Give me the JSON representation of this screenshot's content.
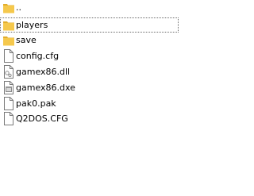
{
  "files": [
    {
      "name": "..",
      "icon": "folder-icon",
      "kind": "folder"
    },
    {
      "name": "players",
      "icon": "folder-icon",
      "kind": "folder",
      "focused": true
    },
    {
      "name": "save",
      "icon": "folder-icon",
      "kind": "folder"
    },
    {
      "name": "config.cfg",
      "icon": "document-icon",
      "kind": "file"
    },
    {
      "name": "gamex86.dll",
      "icon": "dll-file-icon",
      "kind": "file"
    },
    {
      "name": "gamex86.dxe",
      "icon": "executable-file-icon",
      "kind": "file"
    },
    {
      "name": "pak0.pak",
      "icon": "document-icon",
      "kind": "file"
    },
    {
      "name": "Q2DOS.CFG",
      "icon": "document-icon",
      "kind": "file"
    }
  ],
  "colors": {
    "folder_fill": "#f5c84c",
    "folder_tab": "#e2ad2b",
    "doc_border": "#7a7a7a",
    "doc_fill": "#ffffff",
    "focus_outline": "#6a6a6a"
  }
}
